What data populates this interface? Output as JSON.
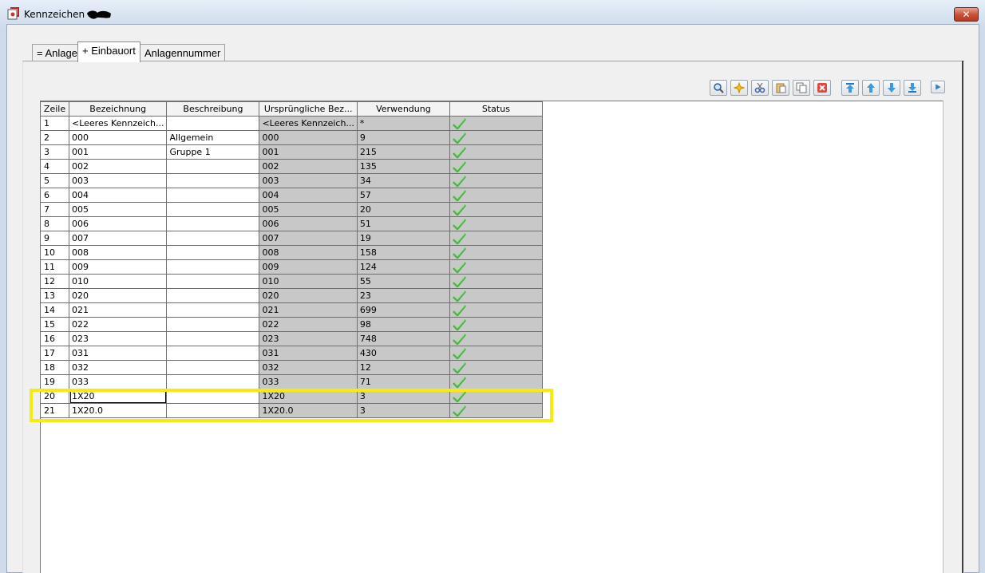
{
  "window": {
    "title": "Kennzeichen -",
    "icon": "app-icon",
    "close_label": "✕"
  },
  "tabs": [
    {
      "label": "= Anlage",
      "active": false
    },
    {
      "label": "+ Einbauort",
      "active": true
    },
    {
      "label": "Anlagennummer",
      "active": false
    }
  ],
  "toolbar": {
    "buttons": [
      {
        "icon": "search-icon"
      },
      {
        "icon": "new-icon"
      },
      {
        "icon": "cut-icon"
      },
      {
        "icon": "paste-icon"
      },
      {
        "icon": "copy-icon"
      },
      {
        "icon": "delete-icon"
      },
      {
        "icon": "move-top-icon"
      },
      {
        "icon": "move-up-icon"
      },
      {
        "icon": "move-down-icon"
      },
      {
        "icon": "move-bottom-icon"
      },
      {
        "icon": "play-icon"
      }
    ]
  },
  "grid": {
    "columns": [
      "Zeile",
      "Bezeichnung",
      "Beschreibung",
      "Ursprüngliche Bez...",
      "Verwendung",
      "Status"
    ],
    "rows": [
      {
        "zeile": "1",
        "bezeichnung": "<Leeres Kennzeich...",
        "beschreibung": "",
        "urspruenglich": "<Leeres Kennzeich...",
        "verwendung": "*",
        "status": "ok"
      },
      {
        "zeile": "2",
        "bezeichnung": "000",
        "beschreibung": "Allgemein",
        "urspruenglich": "000",
        "verwendung": "9",
        "status": "ok"
      },
      {
        "zeile": "3",
        "bezeichnung": "001",
        "beschreibung": "Gruppe 1",
        "urspruenglich": "001",
        "verwendung": "215",
        "status": "ok"
      },
      {
        "zeile": "4",
        "bezeichnung": "002",
        "beschreibung": "",
        "urspruenglich": "002",
        "verwendung": "135",
        "status": "ok"
      },
      {
        "zeile": "5",
        "bezeichnung": "003",
        "beschreibung": "",
        "urspruenglich": "003",
        "verwendung": "34",
        "status": "ok"
      },
      {
        "zeile": "6",
        "bezeichnung": "004",
        "beschreibung": "",
        "urspruenglich": "004",
        "verwendung": "57",
        "status": "ok"
      },
      {
        "zeile": "7",
        "bezeichnung": "005",
        "beschreibung": "",
        "urspruenglich": "005",
        "verwendung": "20",
        "status": "ok"
      },
      {
        "zeile": "8",
        "bezeichnung": "006",
        "beschreibung": "",
        "urspruenglich": "006",
        "verwendung": "51",
        "status": "ok"
      },
      {
        "zeile": "9",
        "bezeichnung": "007",
        "beschreibung": "",
        "urspruenglich": "007",
        "verwendung": "19",
        "status": "ok"
      },
      {
        "zeile": "10",
        "bezeichnung": "008",
        "beschreibung": "",
        "urspruenglich": "008",
        "verwendung": "158",
        "status": "ok"
      },
      {
        "zeile": "11",
        "bezeichnung": "009",
        "beschreibung": "",
        "urspruenglich": "009",
        "verwendung": "124",
        "status": "ok"
      },
      {
        "zeile": "12",
        "bezeichnung": "010",
        "beschreibung": "",
        "urspruenglich": "010",
        "verwendung": "55",
        "status": "ok"
      },
      {
        "zeile": "13",
        "bezeichnung": "020",
        "beschreibung": "",
        "urspruenglich": "020",
        "verwendung": "23",
        "status": "ok"
      },
      {
        "zeile": "14",
        "bezeichnung": "021",
        "beschreibung": "",
        "urspruenglich": "021",
        "verwendung": "699",
        "status": "ok"
      },
      {
        "zeile": "15",
        "bezeichnung": "022",
        "beschreibung": "",
        "urspruenglich": "022",
        "verwendung": "98",
        "status": "ok"
      },
      {
        "zeile": "16",
        "bezeichnung": "023",
        "beschreibung": "",
        "urspruenglich": "023",
        "verwendung": "748",
        "status": "ok"
      },
      {
        "zeile": "17",
        "bezeichnung": "031",
        "beschreibung": "",
        "urspruenglich": "031",
        "verwendung": "430",
        "status": "ok"
      },
      {
        "zeile": "18",
        "bezeichnung": "032",
        "beschreibung": "",
        "urspruenglich": "032",
        "verwendung": "12",
        "status": "ok"
      },
      {
        "zeile": "19",
        "bezeichnung": "033",
        "beschreibung": "",
        "urspruenglich": "033",
        "verwendung": "71",
        "status": "ok"
      },
      {
        "zeile": "20",
        "bezeichnung": "1X20",
        "beschreibung": "",
        "urspruenglich": "1X20",
        "verwendung": "3",
        "status": "ok"
      },
      {
        "zeile": "21",
        "bezeichnung": "1X20.0",
        "beschreibung": "",
        "urspruenglich": "1X20.0",
        "verwendung": "3",
        "status": "ok"
      }
    ],
    "status_icon": "checkmark-icon",
    "status_color": "#4caf50"
  },
  "highlight": {
    "rows": [
      "20",
      "21"
    ],
    "color": "#f5ec0d"
  }
}
